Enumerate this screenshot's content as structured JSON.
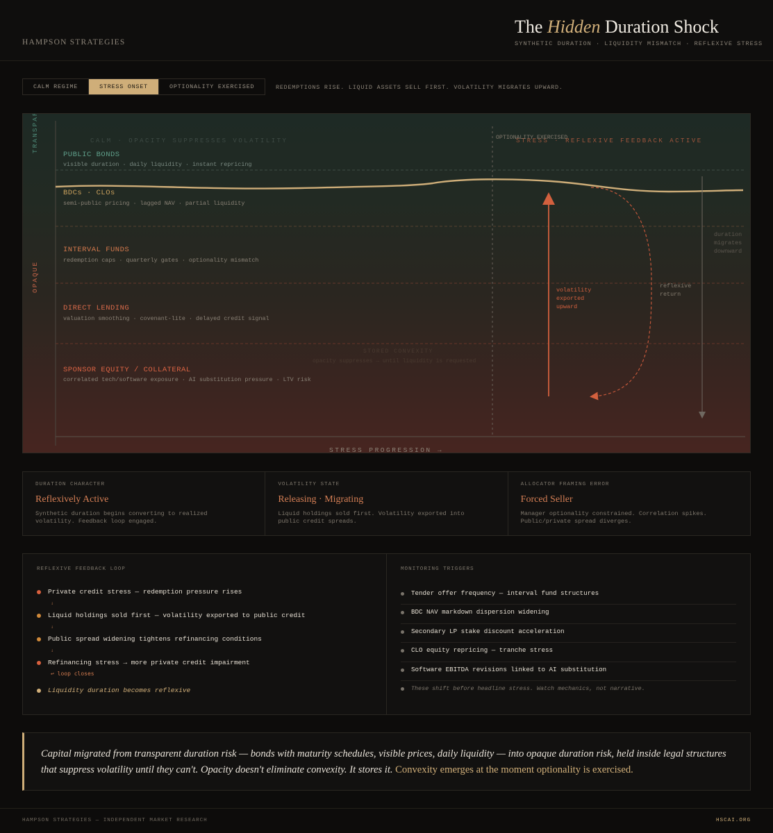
{
  "header": {
    "brand": "HAMPSON STRATEGIES",
    "title_pre": "The ",
    "title_em": "Hidden",
    "title_post": " Duration Shock",
    "subtitle": "SYNTHETIC DURATION · LIQUIDITY MISMATCH · REFLEXIVE STRESS"
  },
  "tabs": [
    {
      "label": "CALM REGIME",
      "active": false
    },
    {
      "label": "STRESS ONSET",
      "active": true
    },
    {
      "label": "OPTIONALITY EXERCISED",
      "active": false
    }
  ],
  "tab_description": "REDEMPTIONS RISE. LIQUID ASSETS SELL FIRST. VOLATILITY MIGRATES UPWARD.",
  "chart": {
    "axis_top": "TRANSPARENT",
    "axis_bottom": "OPAQUE",
    "x_axis_label": "STRESS PROGRESSION →",
    "ghost_calm": "CALM · OPACITY SUPPRESSES VOLATILITY",
    "ghost_stress": "STRESS · REFLEXIVE FEEDBACK ACTIVE",
    "ghost_stored_1": "STORED CONVEXITY",
    "ghost_stored_2": "opacity suppresses → until liquidity is requested",
    "optionality_label": "OPTIONALITY EXERCISED",
    "tiers": [
      {
        "name": "PUBLIC BONDS",
        "desc": "visible duration · daily liquidity · instant repricing",
        "color": "#5f9f8a"
      },
      {
        "name": "BDCs · CLOs",
        "desc": "semi-public pricing · lagged NAV · partial liquidity",
        "color": "#c9a05c"
      },
      {
        "name": "INTERVAL FUNDS",
        "desc": "redemption caps · quarterly gates · optionality mismatch",
        "color": "#d4794d"
      },
      {
        "name": "DIRECT LENDING",
        "desc": "valuation smoothing · covenant-lite · delayed credit signal",
        "color": "#d86a4a"
      },
      {
        "name": "SPONSOR EQUITY / COLLATERAL",
        "desc": "correlated tech/software exposure · AI substitution pressure · LTV risk",
        "color": "#dc6444"
      }
    ],
    "vol_label": [
      "volatility",
      "exported",
      "upward"
    ],
    "reflexive_label": [
      "reflexive",
      "return"
    ],
    "duration_label": [
      "duration",
      "migrates",
      "downward"
    ]
  },
  "cards": [
    {
      "label": "DURATION CHARACTER",
      "value": "Reflexively Active",
      "desc": "Synthetic duration begins converting to realized volatility. Feedback loop engaged."
    },
    {
      "label": "VOLATILITY STATE",
      "value": "Releasing · Migrating",
      "desc": "Liquid holdings sold first. Volatility exported into public credit spreads."
    },
    {
      "label": "ALLOCATOR FRAMING ERROR",
      "value": "Forced Seller",
      "desc": "Manager optionality constrained. Correlation spikes. Public/private spread diverges."
    }
  ],
  "feedback_loop": {
    "title": "REFLEXIVE FEEDBACK LOOP",
    "items": [
      {
        "text": "Private credit stress — redemption pressure rises",
        "color": "#d9603e"
      },
      {
        "text": "Liquid holdings sold first — volatility exported to public credit",
        "color": "#d08a3a"
      },
      {
        "text": "Public spread widening tightens refinancing conditions",
        "color": "#d08a3a"
      },
      {
        "text": "Refinancing stress → more private credit impairment",
        "color": "#d9603e"
      }
    ],
    "arrow": "↓",
    "loop_closes": "↩ loop closes",
    "final": "Liquidity duration becomes reflexive",
    "final_color": "#d2b07a"
  },
  "monitoring": {
    "title": "MONITORING TRIGGERS",
    "items": [
      "Tender offer frequency — interval fund structures",
      "BDC NAV markdown dispersion widening",
      "Secondary LP stake discount acceleration",
      "CLO equity repricing — tranche stress",
      "Software EBITDA revisions linked to AI substitution",
      "These shift before headline stress. Watch mechanics, not narrative."
    ]
  },
  "quote": {
    "text": "Capital migrated from transparent duration risk — bonds with maturity schedules, visible prices, daily liquidity — into opaque duration risk, held inside legal structures that suppress volatility until they can't. Opacity doesn't eliminate convexity. It stores it. ",
    "highlight": "Convexity emerges at the moment optionality is exercised."
  },
  "footer": {
    "left": "HAMPSON STRATEGIES — INDEPENDENT MARKET RESEARCH",
    "right": "HSCAI.ORG"
  }
}
